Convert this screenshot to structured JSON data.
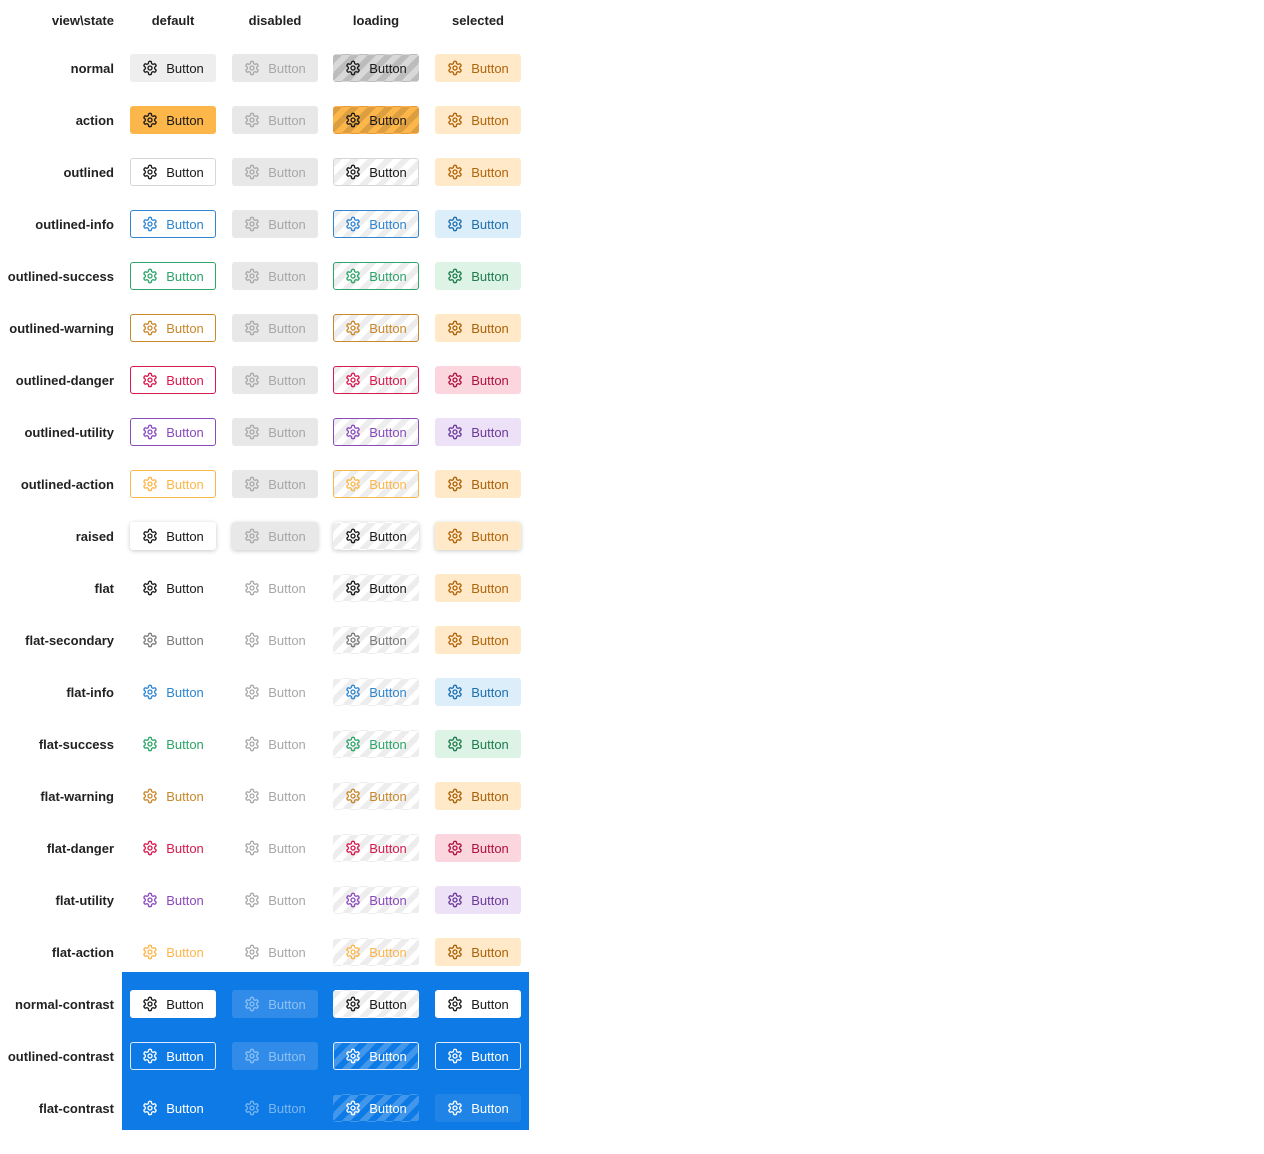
{
  "header": {
    "corner": "view\\state",
    "columns": [
      "default",
      "disabled",
      "loading",
      "selected"
    ]
  },
  "button_label": "Button",
  "icon": "gear-icon",
  "colors": {
    "contrast_bg": "#0e7ae5",
    "action": "#fdb64a",
    "info": "#2e86d1",
    "success": "#2ea56a",
    "warning": "#c9882c",
    "danger": "#d81a4e",
    "utility": "#8a4bbd",
    "disabled_bg": "#e8e8e8",
    "disabled_fg": "#a8a8a8"
  },
  "rows": [
    {
      "name": "normal"
    },
    {
      "name": "action"
    },
    {
      "name": "outlined"
    },
    {
      "name": "outlined-info"
    },
    {
      "name": "outlined-success"
    },
    {
      "name": "outlined-warning"
    },
    {
      "name": "outlined-danger"
    },
    {
      "name": "outlined-utility"
    },
    {
      "name": "outlined-action"
    },
    {
      "name": "raised"
    },
    {
      "name": "flat"
    },
    {
      "name": "flat-secondary"
    },
    {
      "name": "flat-info"
    },
    {
      "name": "flat-success"
    },
    {
      "name": "flat-warning"
    },
    {
      "name": "flat-danger"
    },
    {
      "name": "flat-utility"
    },
    {
      "name": "flat-action"
    },
    {
      "name": "normal-contrast"
    },
    {
      "name": "outlined-contrast"
    },
    {
      "name": "flat-contrast"
    }
  ]
}
